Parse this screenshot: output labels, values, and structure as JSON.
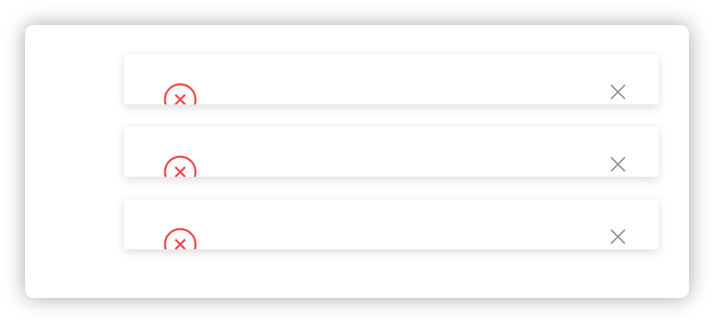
{
  "notifications": [
    {
      "kind": "error",
      "closable": true
    },
    {
      "kind": "error",
      "closable": true
    },
    {
      "kind": "error",
      "closable": true
    }
  ]
}
